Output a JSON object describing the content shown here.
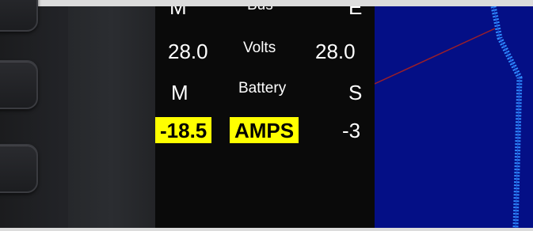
{
  "elec": {
    "header": {
      "left": "M",
      "center": "Bus",
      "right": "E"
    },
    "volts_row": {
      "left_value": "28.0",
      "label": "Volts",
      "right_value": "28.0"
    },
    "battery_row": {
      "left": "M",
      "label": "Battery",
      "right": "S"
    },
    "amps_row": {
      "left_value": "-18.5",
      "label": "AMPS",
      "right_value": "-3"
    }
  },
  "colors": {
    "highlight": "#ffff00",
    "display_bg": "#0a0a0a",
    "map_bg": "#040f86",
    "course_line": "#2f8cff",
    "bearing_line": "#9a1f2a"
  },
  "icons": {
    "softkeys": [
      "softkey-top",
      "softkey-middle",
      "softkey-bottom"
    ]
  }
}
